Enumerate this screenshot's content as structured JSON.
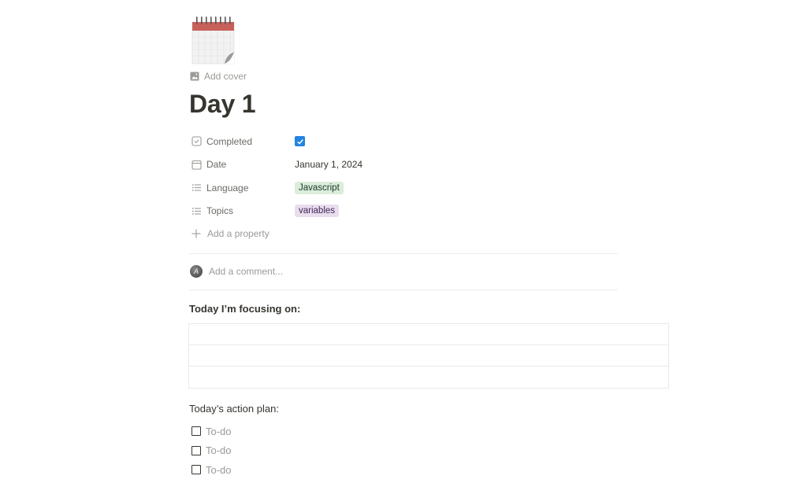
{
  "page": {
    "icon": "calendar-icon",
    "add_cover_label": "Add cover",
    "title": "Day 1"
  },
  "properties": [
    {
      "name": "Completed",
      "icon": "checkbox-prop-icon",
      "type": "checkbox",
      "checked": true
    },
    {
      "name": "Date",
      "icon": "calendar-prop-icon",
      "type": "date",
      "value": "January 1, 2024"
    },
    {
      "name": "Language",
      "icon": "multiselect-icon",
      "type": "multi_select",
      "value": "Javascript",
      "color": "#dbeddb"
    },
    {
      "name": "Topics",
      "icon": "multiselect-icon",
      "type": "multi_select",
      "value": "variables",
      "color": "#e8deee"
    }
  ],
  "add_property_label": "Add a property",
  "comment": {
    "placeholder": "Add a comment..."
  },
  "focus": {
    "heading": "Today I’m focusing on:",
    "rows": [
      "",
      "",
      ""
    ]
  },
  "plan": {
    "heading": "Today’s action plan:",
    "todos": [
      "To-do",
      "To-do",
      "To-do"
    ]
  }
}
